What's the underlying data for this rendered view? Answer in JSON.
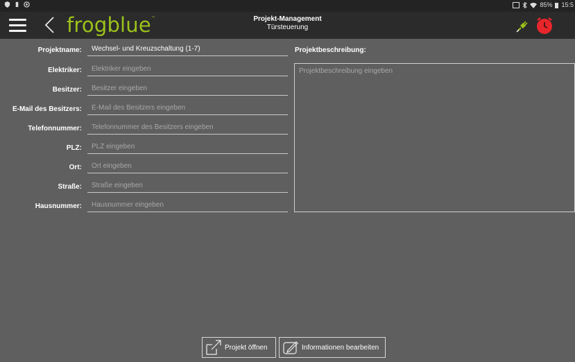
{
  "status_bar": {
    "battery": "85%",
    "time": "15:5"
  },
  "app_bar": {
    "logo": "frogblue",
    "logo_tm": "™",
    "title": "Projekt-Management",
    "subtitle": "Türsteuerung"
  },
  "form": {
    "fields": [
      {
        "label": "Projektname:",
        "value": "Wechsel- und Kreuzschaltung (1-7)",
        "placeholder": ""
      },
      {
        "label": "Elektriker:",
        "value": "",
        "placeholder": "Elektriker eingeben"
      },
      {
        "label": "Besitzer:",
        "value": "",
        "placeholder": "Besitzer eingeben"
      },
      {
        "label": "E-Mail des Besitzers:",
        "value": "",
        "placeholder": "E-Mail des Besitzers eingeben"
      },
      {
        "label": "Telefonnummer:",
        "value": "",
        "placeholder": "Telefonnummer des Besitzers eingeben"
      },
      {
        "label": "PLZ:",
        "value": "",
        "placeholder": "PLZ eingeben"
      },
      {
        "label": "Ort:",
        "value": "",
        "placeholder": "Ort eingeben"
      },
      {
        "label": "Straße:",
        "value": "",
        "placeholder": "Straße eingeben"
      },
      {
        "label": "Hausnummer:",
        "value": "",
        "placeholder": "Hausnummer eingeben"
      }
    ]
  },
  "description": {
    "label": "Projektbeschreibung:",
    "placeholder": "Projektbeschreibung eingeben"
  },
  "buttons": {
    "open_project": "Projekt öffnen",
    "edit_info": "Informationen bearbeiten"
  },
  "colors": {
    "background": "#5f5f5f",
    "app_bar": "#2b2b2b",
    "status_bar": "#232323",
    "brand_green": "#9cc21a",
    "alarm_red": "#e8262b"
  },
  "icons": [
    "menu-icon",
    "back-icon",
    "plug-icon",
    "alarm-clock-icon",
    "open-project-icon",
    "edit-icon"
  ]
}
